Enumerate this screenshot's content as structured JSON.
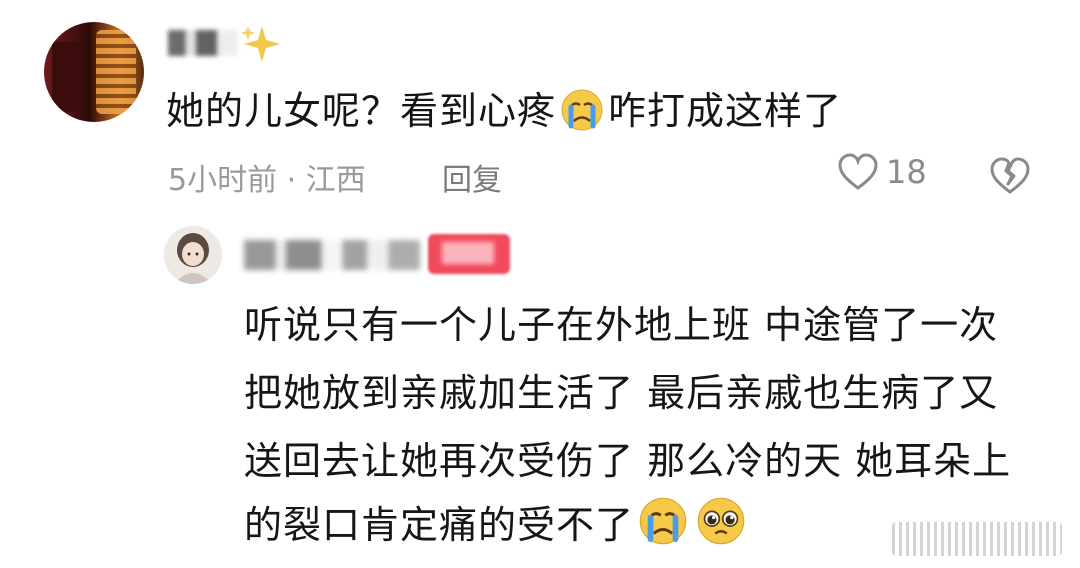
{
  "comment": {
    "text_before": "她的儿女呢？看到心疼",
    "emoji": "crying-face",
    "text_after": "咋打成这样了",
    "time_location": "5小时前 · 江西",
    "reply_label": "回复",
    "like_count": "18"
  },
  "reply": {
    "lines": [
      "听说只有一个儿子在外地上班 中途管了一次",
      "把她放到亲戚加生活了 最后亲戚也生病了又",
      "送回去让她再次受伤了 那么冷的天 她耳朵上"
    ],
    "last_line_text": "的裂口肯定痛的受不了",
    "last_line_emojis": [
      "crying-face",
      "pleading-face"
    ]
  },
  "colors": {
    "text": "#161616",
    "meta": "#9a9a9a",
    "badge": "#f04a5d",
    "emoji_yellow": "#f7c948",
    "emoji_tears": "#4a9be8"
  }
}
